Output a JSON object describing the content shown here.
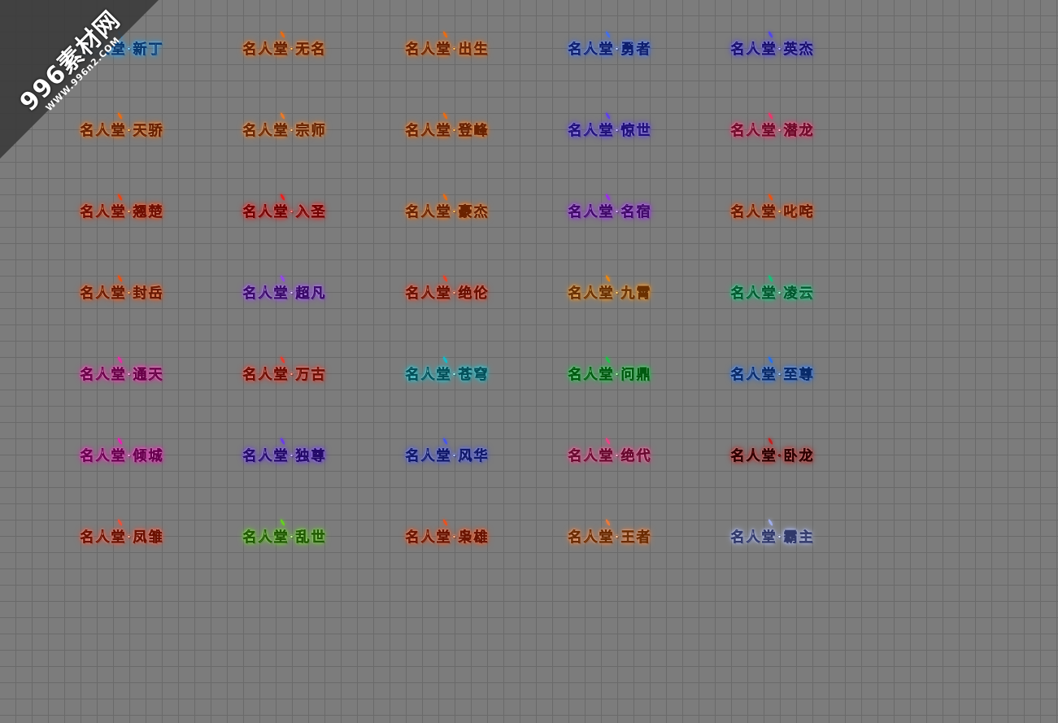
{
  "watermark": {
    "main": "996素材网",
    "sub": "WWW.996n2.COM"
  },
  "titles": [
    {
      "text": "名人堂·新丁",
      "color": "#9fe3ff",
      "glow": "#1aa0ff",
      "dark": "#0a3a70"
    },
    {
      "text": "名人堂·无名",
      "color": "#ffd27a",
      "glow": "#ff6a00",
      "dark": "#6a2200"
    },
    {
      "text": "名人堂·出生",
      "color": "#ffd27a",
      "glow": "#ff6a00",
      "dark": "#6a2200"
    },
    {
      "text": "名人堂·勇者",
      "color": "#cfe0ff",
      "glow": "#3a6dff",
      "dark": "#0e1f70"
    },
    {
      "text": "名人堂·英杰",
      "color": "#c9c4ff",
      "glow": "#4b3dff",
      "dark": "#1a1070"
    },
    {
      "text": "名人堂·天骄",
      "color": "#ffd27a",
      "glow": "#ff6a00",
      "dark": "#6a2200"
    },
    {
      "text": "名人堂·宗师",
      "color": "#ffd9a0",
      "glow": "#ff7a1a",
      "dark": "#6a2600"
    },
    {
      "text": "名人堂·登峰",
      "color": "#ffd27a",
      "glow": "#ff6a00",
      "dark": "#6a2200"
    },
    {
      "text": "名人堂·惊世",
      "color": "#d8ccff",
      "glow": "#5a36ff",
      "dark": "#20107a"
    },
    {
      "text": "名人堂·潜龙",
      "color": "#ffc4d8",
      "glow": "#ff2a6a",
      "dark": "#700a2a"
    },
    {
      "text": "名人堂·翘楚",
      "color": "#ffcf8a",
      "glow": "#ff3a00",
      "dark": "#700e00"
    },
    {
      "text": "名人堂·入圣",
      "color": "#ff9a9a",
      "glow": "#ff1010",
      "dark": "#700000"
    },
    {
      "text": "名人堂·豪杰",
      "color": "#ffd27a",
      "glow": "#ff6a00",
      "dark": "#6a2200"
    },
    {
      "text": "名人堂·名宿",
      "color": "#e6c8ff",
      "glow": "#a020ff",
      "dark": "#40086a"
    },
    {
      "text": "名人堂·叱咤",
      "color": "#ffd27a",
      "glow": "#ff4a00",
      "dark": "#6a1800"
    },
    {
      "text": "名人堂·封岳",
      "color": "#ffc27a",
      "glow": "#ff4a00",
      "dark": "#6a1800"
    },
    {
      "text": "名人堂·超凡",
      "color": "#e9d6ff",
      "glow": "#9a40ff",
      "dark": "#3a0a6a"
    },
    {
      "text": "名人堂·绝伦",
      "color": "#ffc2a8",
      "glow": "#ff3a1a",
      "dark": "#6a1000"
    },
    {
      "text": "名人堂·九霄",
      "color": "#ffe08a",
      "glow": "#ff8a00",
      "dark": "#6a3000"
    },
    {
      "text": "名人堂·凌云",
      "color": "#b8ffe0",
      "glow": "#00d07a",
      "dark": "#005a30"
    },
    {
      "text": "名人堂·通天",
      "color": "#ffc4ea",
      "glow": "#ff20b0",
      "dark": "#6a0048"
    },
    {
      "text": "名人堂·万古",
      "color": "#ffb8a8",
      "glow": "#ff3020",
      "dark": "#6a0a00"
    },
    {
      "text": "名人堂·苍穹",
      "color": "#c4fff6",
      "glow": "#00c8d8",
      "dark": "#00505a"
    },
    {
      "text": "名人堂·问鼎",
      "color": "#c4ffc4",
      "glow": "#10d040",
      "dark": "#005a10"
    },
    {
      "text": "名人堂·至尊",
      "color": "#b8d8ff",
      "glow": "#1a70ff",
      "dark": "#082a6a"
    },
    {
      "text": "名人堂·倾城",
      "color": "#ffc0ee",
      "glow": "#ff10c0",
      "dark": "#6a0050"
    },
    {
      "text": "名人堂·独尊",
      "color": "#d8c8ff",
      "glow": "#6a30ff",
      "dark": "#240a6a"
    },
    {
      "text": "名人堂·风华",
      "color": "#c8d8ff",
      "glow": "#4050ff",
      "dark": "#10186a"
    },
    {
      "text": "名人堂·绝代",
      "color": "#ffc8de",
      "glow": "#ff3a8a",
      "dark": "#6a0a30"
    },
    {
      "text": "名人堂·卧龙",
      "color": "#8a1010",
      "glow": "#d01010",
      "dark": "#300000"
    },
    {
      "text": "名人堂·凤雏",
      "color": "#ffc2b0",
      "glow": "#ff4a30",
      "dark": "#6a1000"
    },
    {
      "text": "名人堂·乱世",
      "color": "#d8ffb0",
      "glow": "#60e010",
      "dark": "#205a00"
    },
    {
      "text": "名人堂·枭雄",
      "color": "#ffc8a0",
      "glow": "#ff4a10",
      "dark": "#6a1400"
    },
    {
      "text": "名人堂·王者",
      "color": "#ffd8b8",
      "glow": "#ff7a30",
      "dark": "#6a2a00"
    },
    {
      "text": "名人堂·霸主",
      "color": "#eef2ff",
      "glow": "#a8b8ff",
      "dark": "#30386a"
    }
  ]
}
